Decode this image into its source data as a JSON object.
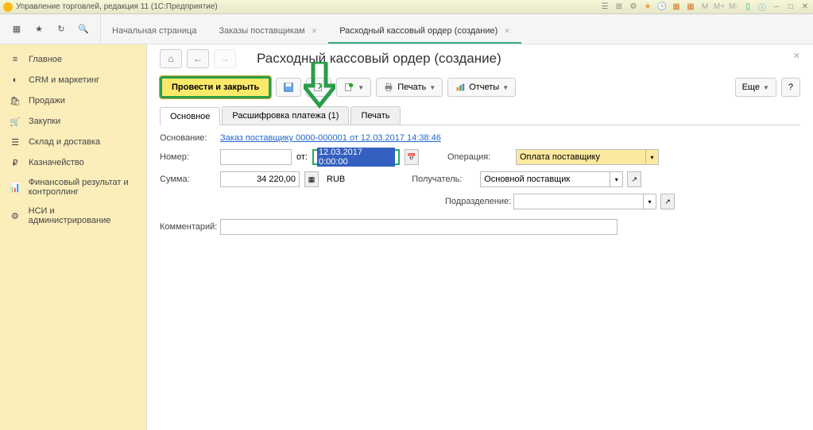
{
  "window": {
    "title": "Управление торговлей, редакция 11  (1С:Предприятие)"
  },
  "tabs": {
    "items": [
      {
        "label": "Начальная страница"
      },
      {
        "label": "Заказы поставщикам"
      },
      {
        "label": "Расходный кассовый ордер (создание)",
        "active": true
      }
    ]
  },
  "sidebar": {
    "items": [
      {
        "label": "Главное",
        "icon": "menu"
      },
      {
        "label": "CRM и маркетинг",
        "icon": "pie"
      },
      {
        "label": "Продажи",
        "icon": "bag"
      },
      {
        "label": "Закупки",
        "icon": "cart"
      },
      {
        "label": "Склад и доставка",
        "icon": "stack"
      },
      {
        "label": "Казначейство",
        "icon": "coin"
      },
      {
        "label": "Финансовый результат и контроллинг",
        "icon": "bars"
      },
      {
        "label": "НСИ и администрирование",
        "icon": "gear"
      }
    ]
  },
  "page": {
    "title": "Расходный кассовый ордер (создание)"
  },
  "toolbar": {
    "post_close": "Провести и закрыть",
    "print": "Печать",
    "reports": "Отчеты",
    "more": "Еще"
  },
  "subtabs": {
    "main": "Основное",
    "decode": "Расшифровка платежа (1)",
    "print": "Печать"
  },
  "form": {
    "basis_label": "Основание:",
    "basis_link": "Заказ поставщику 0000-000001 от 12.03.2017 14:38:46",
    "number_label": "Номер:",
    "number_value": "",
    "from_label": "от:",
    "date_value": "12.03.2017  0:00:00",
    "operation_label": "Операция:",
    "operation_value": "Оплата поставщику",
    "sum_label": "Сумма:",
    "sum_value": "34 220,00",
    "currency": "RUB",
    "recipient_label": "Получатель:",
    "recipient_value": "Основной поставщик",
    "division_label": "Подразделение:",
    "division_value": "",
    "comment_label": "Комментарий:"
  }
}
